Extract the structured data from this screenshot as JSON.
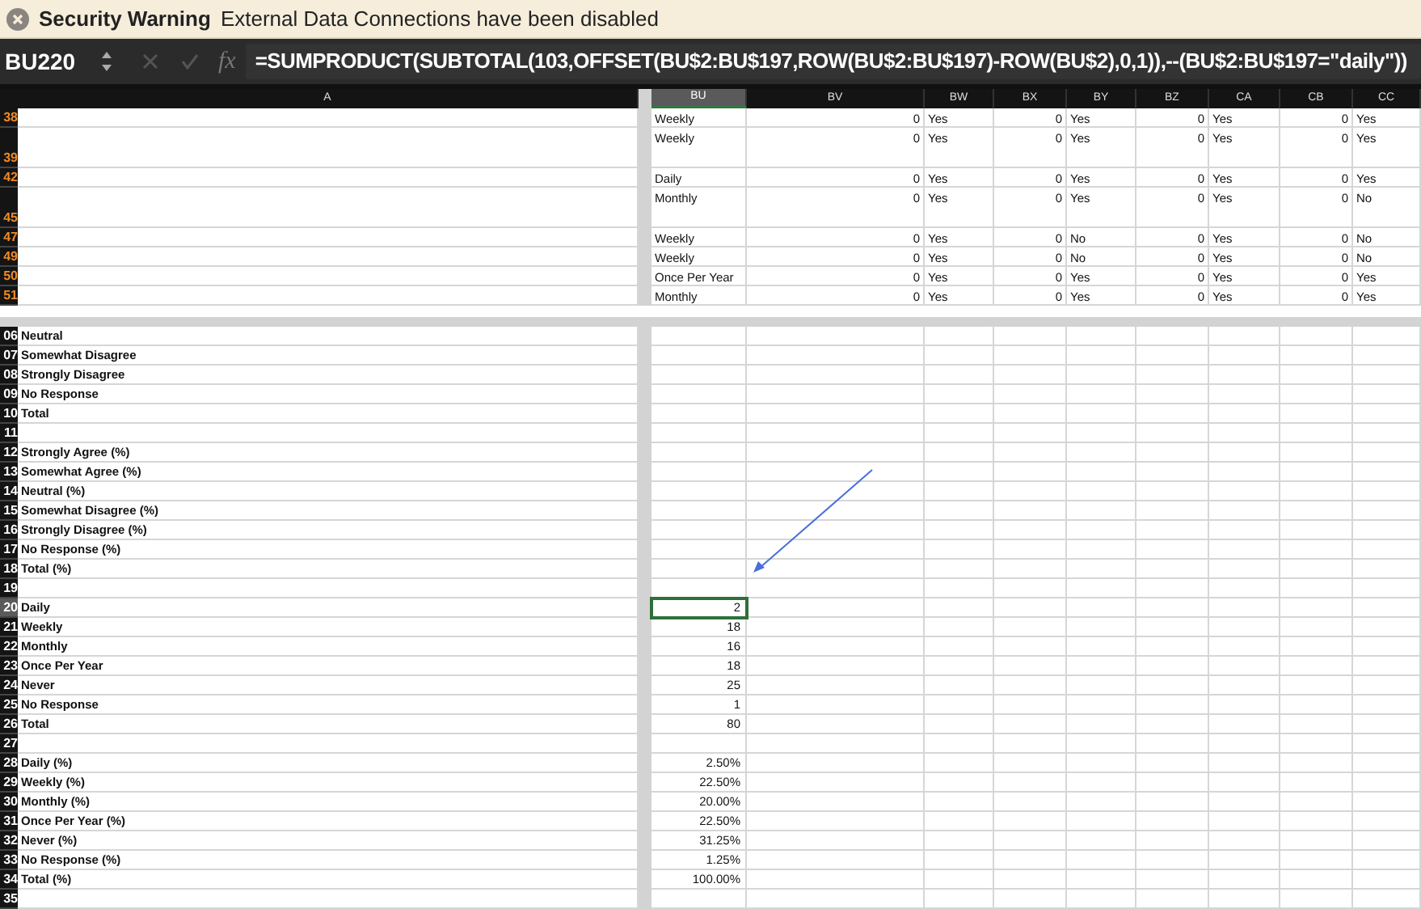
{
  "security_bar": {
    "title": "Security Warning",
    "message": "External Data Connections have been disabled"
  },
  "formula_bar": {
    "name_box": "BU220",
    "fx": "fx",
    "formula": "=SUMPRODUCT(SUBTOTAL(103,OFFSET(BU$2:BU$197,ROW(BU$2:BU$197)-ROW(BU$2),0,1)),--(BU$2:BU$197=\"daily\"))"
  },
  "columns": [
    {
      "label": "A",
      "selected": false
    },
    {
      "label": "BU",
      "selected": true
    },
    {
      "label": "BV",
      "selected": false
    },
    {
      "label": "BW",
      "selected": false
    },
    {
      "label": "BX",
      "selected": false
    },
    {
      "label": "BY",
      "selected": false
    },
    {
      "label": "BZ",
      "selected": false
    },
    {
      "label": "CA",
      "selected": false
    },
    {
      "label": "CB",
      "selected": false
    },
    {
      "label": "CC",
      "selected": false
    }
  ],
  "top_rows": [
    {
      "row": "38",
      "filtered": true,
      "kind": "single",
      "cells": [
        "Weekly",
        "0",
        "Yes",
        "0",
        "Yes",
        "0",
        "Yes",
        "0",
        "Yes"
      ]
    },
    {
      "row": "39",
      "filtered": true,
      "kind": "tall",
      "cells": [
        "Weekly",
        "0",
        "Yes",
        "0",
        "Yes",
        "0",
        "Yes",
        "0",
        "Yes"
      ]
    },
    {
      "row": "42",
      "filtered": true,
      "kind": "single",
      "cells": [
        "Daily",
        "0",
        "Yes",
        "0",
        "Yes",
        "0",
        "Yes",
        "0",
        "Yes"
      ]
    },
    {
      "row": "45",
      "filtered": true,
      "kind": "tall",
      "cells": [
        "Monthly",
        "0",
        "Yes",
        "0",
        "Yes",
        "0",
        "Yes",
        "0",
        "No"
      ]
    },
    {
      "row": "47",
      "filtered": true,
      "kind": "single",
      "cells": [
        "Weekly",
        "0",
        "Yes",
        "0",
        "No",
        "0",
        "Yes",
        "0",
        "No"
      ]
    },
    {
      "row": "49",
      "filtered": true,
      "kind": "single",
      "cells": [
        "Weekly",
        "0",
        "Yes",
        "0",
        "No",
        "0",
        "Yes",
        "0",
        "No"
      ]
    },
    {
      "row": "50",
      "filtered": true,
      "kind": "single",
      "cells": [
        "Once Per Year",
        "0",
        "Yes",
        "0",
        "Yes",
        "0",
        "Yes",
        "0",
        "Yes"
      ]
    },
    {
      "row": "51",
      "filtered": true,
      "kind": "single",
      "cells": [
        "Monthly",
        "0",
        "Yes",
        "0",
        "Yes",
        "0",
        "Yes",
        "0",
        "Yes"
      ]
    }
  ],
  "bottom_rows": [
    {
      "row": "06",
      "label": "Neutral",
      "selected": false
    },
    {
      "row": "07",
      "label": "Somewhat Disagree",
      "selected": false
    },
    {
      "row": "08",
      "label": "Strongly Disagree",
      "selected": false
    },
    {
      "row": "09",
      "label": "No Response",
      "selected": false
    },
    {
      "row": "10",
      "label": "Total",
      "selected": false
    },
    {
      "row": "11",
      "selected": false
    },
    {
      "row": "12",
      "label": "Strongly Agree (%)",
      "selected": false
    },
    {
      "row": "13",
      "label": "Somewhat Agree  (%)",
      "selected": false
    },
    {
      "row": "14",
      "label": "Neutral  (%)",
      "selected": false
    },
    {
      "row": "15",
      "label": "Somewhat Disagree  (%)",
      "selected": false
    },
    {
      "row": "16",
      "label": "Strongly Disagree  (%)",
      "selected": false
    },
    {
      "row": "17",
      "label": "No Response  (%)",
      "selected": false
    },
    {
      "row": "18",
      "label": "Total (%)",
      "selected": false
    },
    {
      "row": "19",
      "selected": false
    },
    {
      "row": "20",
      "label": "Daily",
      "value": "2",
      "selected": true
    },
    {
      "row": "21",
      "label": "Weekly",
      "value": "18",
      "selected": false
    },
    {
      "row": "22",
      "label": "Monthly",
      "value": "16",
      "selected": false
    },
    {
      "row": "23",
      "label": "Once Per Year",
      "value": "18",
      "selected": false
    },
    {
      "row": "24",
      "label": "Never",
      "value": "25",
      "selected": false
    },
    {
      "row": "25",
      "label": "No Response",
      "value": "1",
      "selected": false
    },
    {
      "row": "26",
      "label": "Total",
      "value": "80",
      "selected": false
    },
    {
      "row": "27",
      "selected": false
    },
    {
      "row": "28",
      "label": "Daily (%)",
      "value": "2.50%",
      "selected": false
    },
    {
      "row": "29",
      "label": "Weekly (%)",
      "value": "22.50%",
      "selected": false
    },
    {
      "row": "30",
      "label": "Monthly (%)",
      "value": "20.00%",
      "selected": false
    },
    {
      "row": "31",
      "label": "Once Per Year (%)",
      "value": "22.50%",
      "selected": false
    },
    {
      "row": "32",
      "label": "Never (%)",
      "value": "31.25%",
      "selected": false
    },
    {
      "row": "33",
      "label": "No Response (%)",
      "value": "1.25%",
      "selected": false
    },
    {
      "row": "34",
      "label": "Total (%)",
      "value": "100.00%",
      "selected": false
    },
    {
      "row": "35",
      "selected": false
    }
  ]
}
